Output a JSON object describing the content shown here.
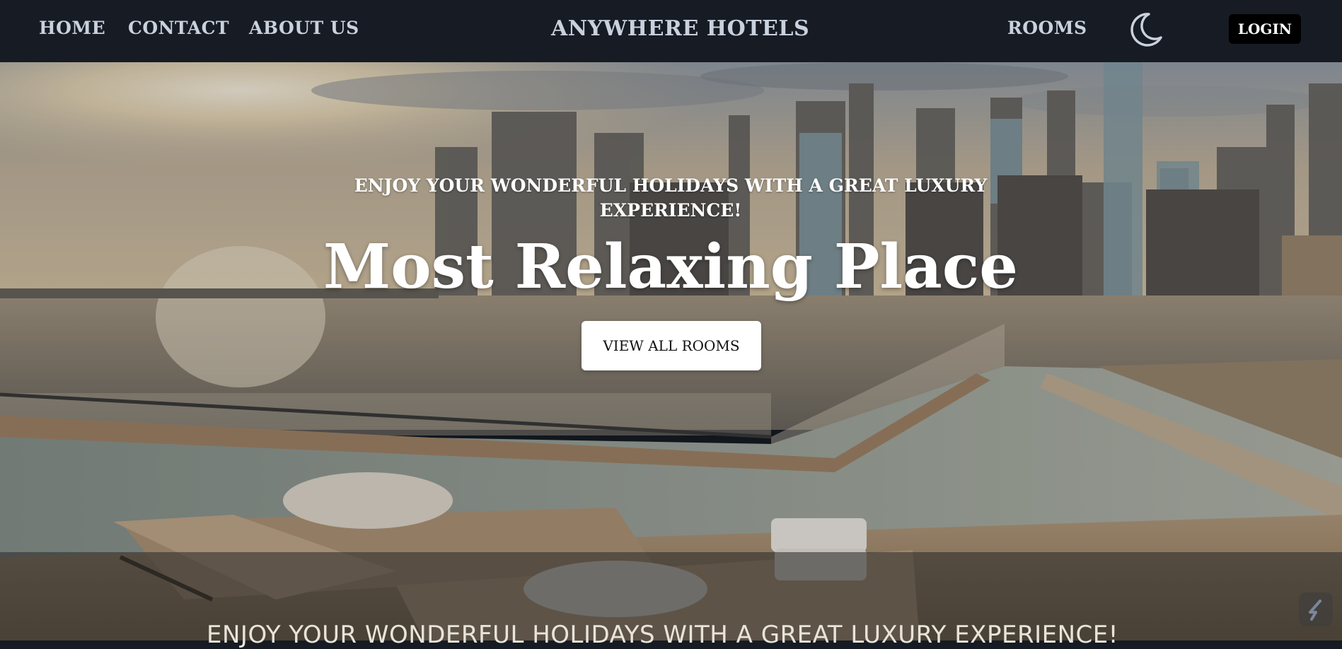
{
  "nav": {
    "home": "HOME",
    "contact": "CONTACT",
    "about": "ABOUT US",
    "brand": "ANYWHERE HOTELS",
    "rooms": "ROOMS",
    "theme_icon": "moon-icon",
    "login": "LOGIN"
  },
  "hero": {
    "tagline": "ENJOY YOUR WONDERFUL HOLIDAYS WITH A GREAT LUXURY EXPERIENCE!",
    "title": "Most Relaxing Place",
    "cta": "VIEW ALL ROOMS",
    "background_image": "rooftop-infinity-pool-city-skyline"
  },
  "marquee": {
    "text": "ENJOY YOUR WONDERFUL HOLIDAYS WITH A GREAT LUXURY EXPERIENCE!"
  },
  "widget": {
    "icon": "slash-badge-icon"
  },
  "colors": {
    "navbar_bg": "#161b24",
    "nav_text": "#c9d1dd",
    "login_bg": "#000000",
    "login_text": "#ffffff",
    "cta_bg": "#ffffff",
    "cta_text": "#111111",
    "hero_text": "#ffffff"
  }
}
